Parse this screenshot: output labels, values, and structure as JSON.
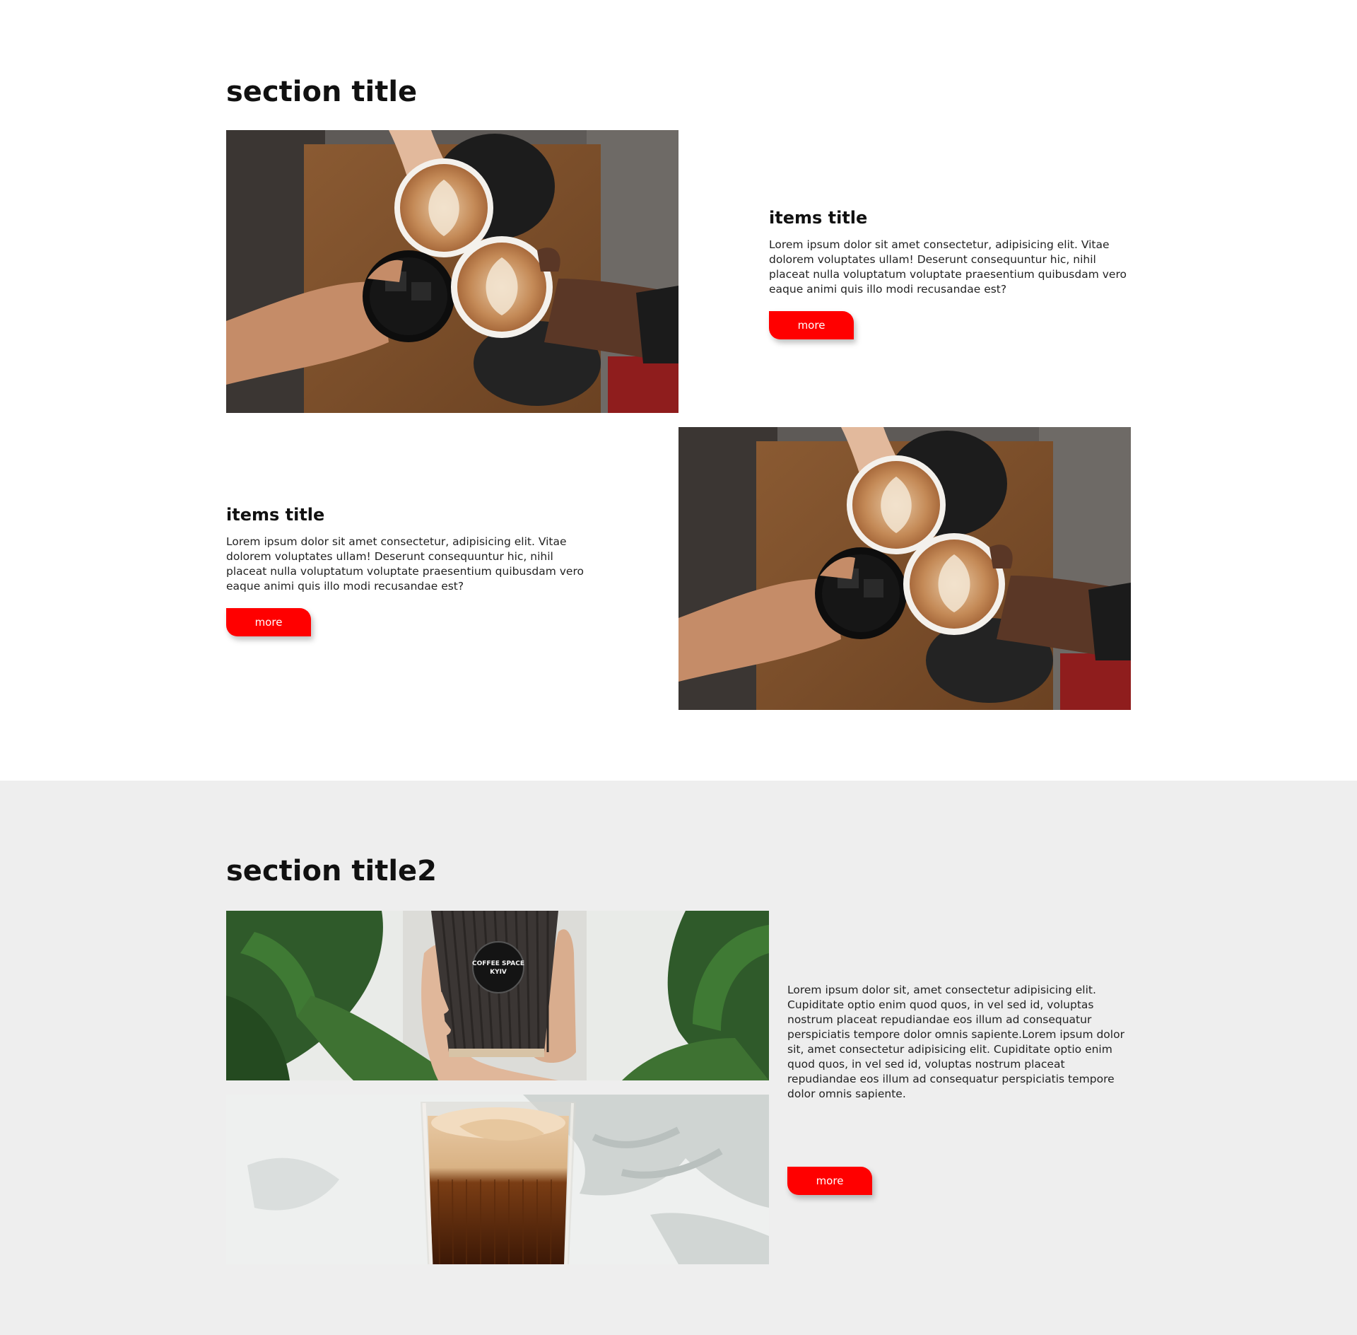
{
  "section1": {
    "title": "section title",
    "items": [
      {
        "title": "items title",
        "description": "Lorem ipsum dolor sit amet consectetur, adipisicing elit. Vitae dolorem voluptates ullam! Deserunt consequuntur hic, nihil placeat nulla voluptatum voluptate praesentium quibusdam vero eaque animi quis illo modi recusandae est?",
        "button_label": "more"
      },
      {
        "title": "items title",
        "description": "Lorem ipsum dolor sit amet consectetur, adipisicing elit. Vitae dolorem voluptates ullam! Deserunt consequuntur hic, nihil placeat nulla voluptatum voluptate praesentium quibusdam vero eaque animi quis illo modi recusandae est?",
        "button_label": "more"
      }
    ]
  },
  "section2": {
    "title": "section title2",
    "description": "Lorem ipsum dolor sit, amet consectetur adipisicing elit. Cupiditate optio enim quod quos, in vel sed id, voluptas nostrum placeat repudiandae eos illum ad consequatur perspiciatis tempore dolor omnis sapiente.Lorem ipsum dolor sit, amet consectetur adipisicing elit. Cupiditate optio enim quod quos, in vel sed id, voluptas nostrum placeat repudiandae eos illum ad consequatur perspiciatis tempore dolor omnis sapiente.",
    "button_label": "more",
    "cup_sticker_text": [
      "COFFEE SPACE",
      "KYIV"
    ]
  },
  "colors": {
    "accent": "#ff0000",
    "section2_background": "#eeeeee",
    "text": "#111111"
  }
}
